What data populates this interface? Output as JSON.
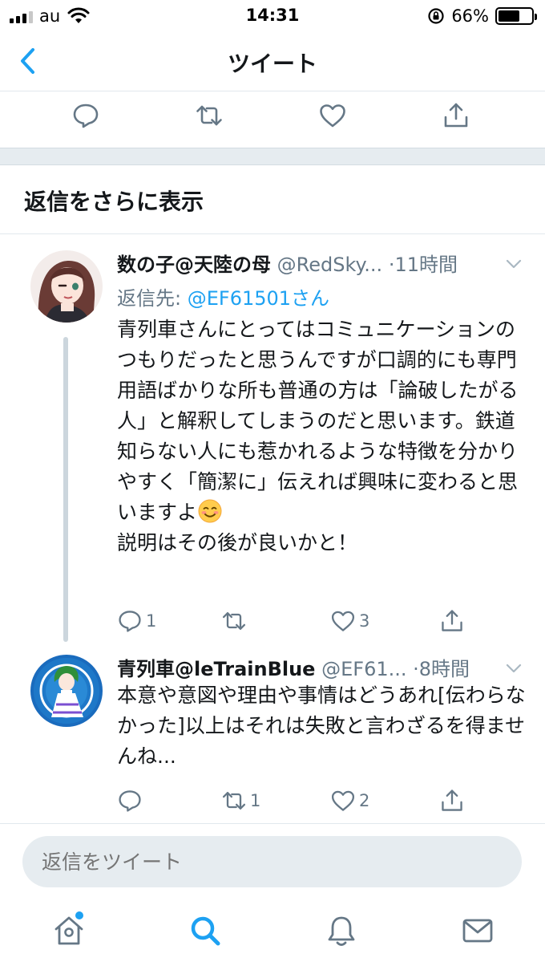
{
  "status_bar": {
    "carrier": "au",
    "time": "14:31",
    "battery_percent": "66%",
    "battery_level": 0.66
  },
  "header": {
    "title": "ツイート"
  },
  "more_replies": {
    "label": "返信をさらに表示"
  },
  "tweets": [
    {
      "name": "数の子@天陸の母",
      "handle": "@RedSky...",
      "time": "·11時間",
      "reply_to_prefix": "返信先: ",
      "reply_to_mention": "@EF61501さん",
      "body_main": "青列車さんにとってはコミュニケーションのつもりだったと思うんですが口調的にも専門用語ばかりな所も普通の方は「論破したがる人」と解釈してしまうのだと思います。鉄道知らない人にも惹かれるような特徴を分かりやすく「簡潔に」伝えれば興味に変わると思いますよ",
      "body_emoji": "smiling-face-icon",
      "body_tail": "説明はその後が良いかと！",
      "replies": "1",
      "retweets": "",
      "likes": "3"
    },
    {
      "name": "青列車@leTrainBlue",
      "handle": "@EF61...",
      "time": "·8時間",
      "body": "本意や意図や理由や事情はどうあれ[伝わらなかった]以上はそれは失敗と言わざるを得ませんね...",
      "replies": "",
      "retweets": "1",
      "likes": "2"
    }
  ],
  "reply_input": {
    "placeholder": "返信をツイート"
  },
  "tab_bar": {
    "items": [
      "home-icon",
      "search-icon",
      "bell-icon",
      "mail-icon"
    ],
    "active": "search-icon"
  },
  "colors": {
    "accent": "#1da1f2",
    "secondary_text": "#657786",
    "icon": "#657786",
    "separator_band": "#e6ecf0"
  }
}
